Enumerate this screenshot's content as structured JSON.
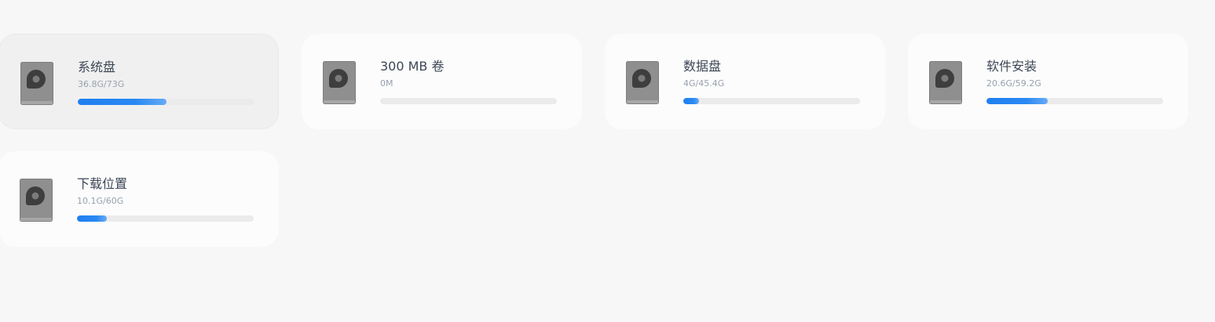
{
  "drives": [
    {
      "name": "系统盘",
      "size": "36.8G/73G",
      "usage": 0.504,
      "selected": true,
      "icon": "hard-drive-icon"
    },
    {
      "name": "300 MB 卷",
      "size": "0M",
      "usage": 0,
      "selected": false,
      "icon": "hard-drive-icon"
    },
    {
      "name": "数据盘",
      "size": "4G/45.4G",
      "usage": 0.088,
      "selected": false,
      "icon": "hard-drive-icon"
    },
    {
      "name": "软件安装",
      "size": "20.6G/59.2G",
      "usage": 0.348,
      "selected": false,
      "icon": "hard-drive-icon"
    },
    {
      "name": "下载位置",
      "size": "10.1G/60G",
      "usage": 0.168,
      "selected": false,
      "icon": "hard-drive-icon"
    }
  ],
  "colors": {
    "accent": "#1f7ff0",
    "icon_body": "#8f8f8f",
    "icon_dark": "#3e3e3e"
  }
}
